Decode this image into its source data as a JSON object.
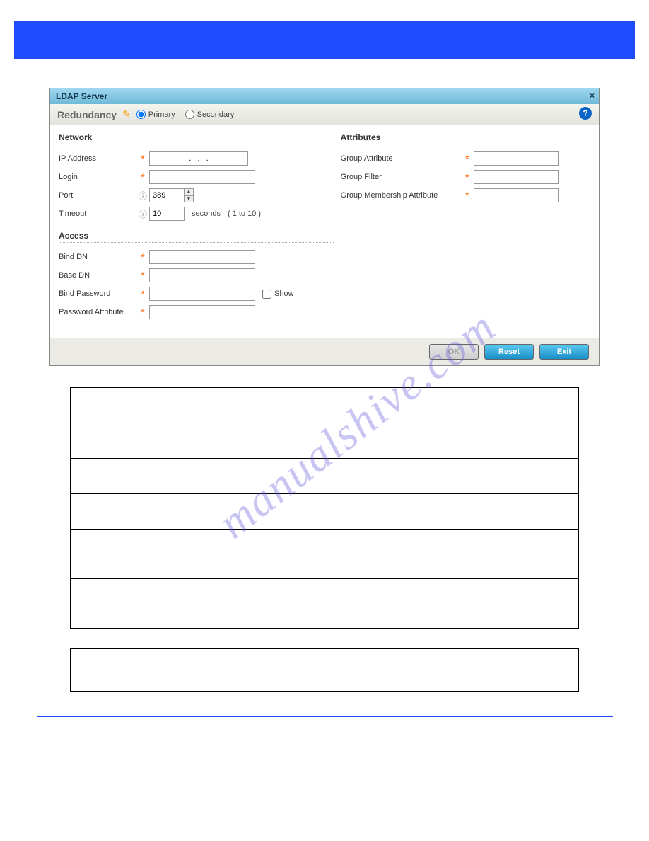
{
  "topbar": {},
  "dialog": {
    "title": "LDAP Server",
    "redundancy": {
      "label": "Redundancy",
      "primary": "Primary",
      "secondary": "Secondary",
      "selected": "primary"
    },
    "network": {
      "heading": "Network",
      "ip_label": "IP Address",
      "ip_value": ".   .   .",
      "login_label": "Login",
      "login_value": "",
      "port_label": "Port",
      "port_value": "389",
      "timeout_label": "Timeout",
      "timeout_value": "10",
      "timeout_unit": "seconds",
      "timeout_hint": "( 1 to 10 )"
    },
    "access": {
      "heading": "Access",
      "bind_dn_label": "Bind DN",
      "bind_dn_value": "",
      "base_dn_label": "Base DN",
      "base_dn_value": "",
      "bind_pw_label": "Bind Password",
      "bind_pw_value": "",
      "show_label": "Show",
      "pw_attr_label": "Password Attribute",
      "pw_attr_value": ""
    },
    "attributes": {
      "heading": "Attributes",
      "group_attr_label": "Group Attribute",
      "group_attr_value": "",
      "group_filter_label": "Group Filter",
      "group_filter_value": "",
      "group_member_label": "Group Membership Attribute",
      "group_member_value": ""
    },
    "buttons": {
      "ok": "OK",
      "reset": "Reset",
      "exit": "Exit"
    }
  },
  "watermark": "manualshive.com",
  "tables": {
    "t1": [
      [
        "",
        ""
      ],
      [
        "",
        ""
      ],
      [
        "",
        ""
      ],
      [
        "",
        ""
      ],
      [
        "",
        ""
      ]
    ],
    "t2": [
      [
        "",
        ""
      ]
    ]
  }
}
